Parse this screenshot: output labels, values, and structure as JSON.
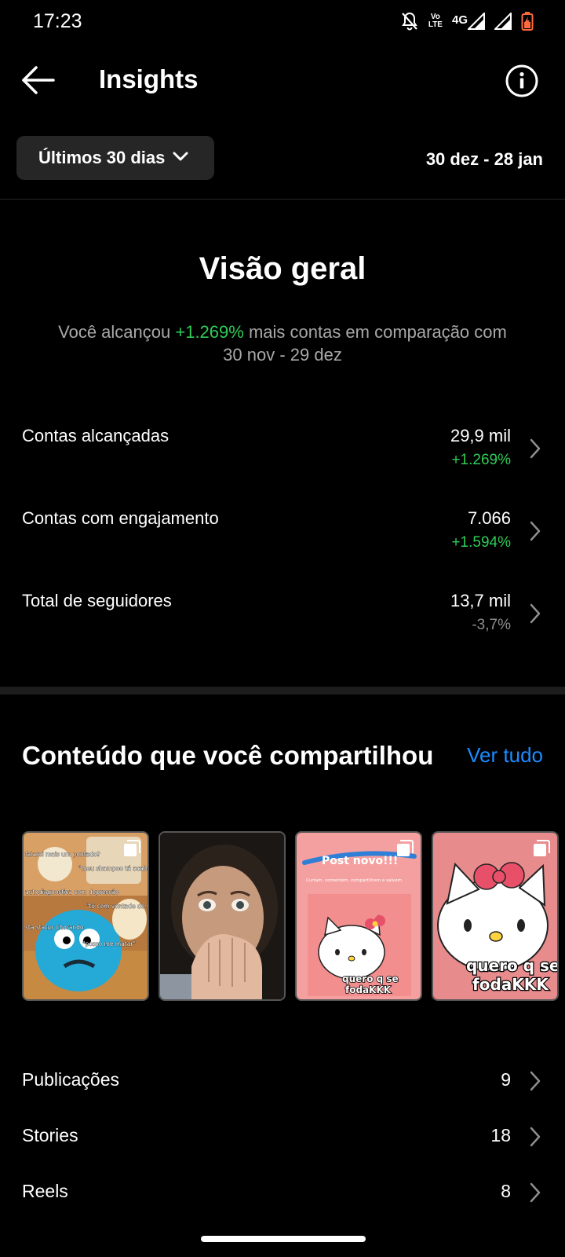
{
  "status_bar": {
    "time": "17:23",
    "volte_top": "Vo",
    "volte_bottom": "LTE",
    "network": "4G"
  },
  "header": {
    "title": "Insights",
    "back_icon": "arrow-left-icon",
    "info_icon": "info-icon"
  },
  "filter": {
    "period": "Últimos 30 dias",
    "date_range": "30 dez - 28 jan"
  },
  "overview": {
    "title": "Visão geral",
    "sub_prefix": "Você alcançou ",
    "sub_highlight": "+1.269%",
    "sub_suffix": " mais contas em comparação com 30 nov - 29 dez",
    "metrics": [
      {
        "label": "Contas alcançadas",
        "value": "29,9 mil",
        "change": "+1.269%"
      },
      {
        "label": "Contas com engajamento",
        "value": "7.066",
        "change": "+1.594%"
      },
      {
        "label": "Total de seguidores",
        "value": "13,7 mil",
        "change": "-3,7%"
      }
    ]
  },
  "content": {
    "title": "Conteúdo que você compartilhou",
    "see_all": "Ver tudo",
    "thumbnails": [
      {
        "kind": "cartoon-meme",
        "multi": true,
        "captions": [
          "falarei mais um pontado?",
          "\"meu shampoo tá acabando\"",
          "autodiagnostica com depressão",
          "\"tô com vontade de ser amado\"",
          "sta status chorando",
          "\"posso me matar\""
        ]
      },
      {
        "kind": "face-video",
        "multi": false
      },
      {
        "kind": "hello-kitty-post",
        "multi": true,
        "heading": "Post novo!!!",
        "subtext": "Curtam, comentem, compartilhem e salvem",
        "caption_line1": "quero q se",
        "caption_line2": "fodaKKK"
      },
      {
        "kind": "hello-kitty-large",
        "multi": true,
        "caption_line1": "quero q se",
        "caption_line2": "fodaKKK"
      }
    ],
    "rows": [
      {
        "label": "Publicações",
        "count": "9"
      },
      {
        "label": "Stories",
        "count": "18"
      },
      {
        "label": "Reels",
        "count": "8"
      }
    ]
  },
  "colors": {
    "positive": "#2ecc57",
    "link": "#1a8cff",
    "background": "#000000",
    "dropdown_bg": "#262626"
  }
}
